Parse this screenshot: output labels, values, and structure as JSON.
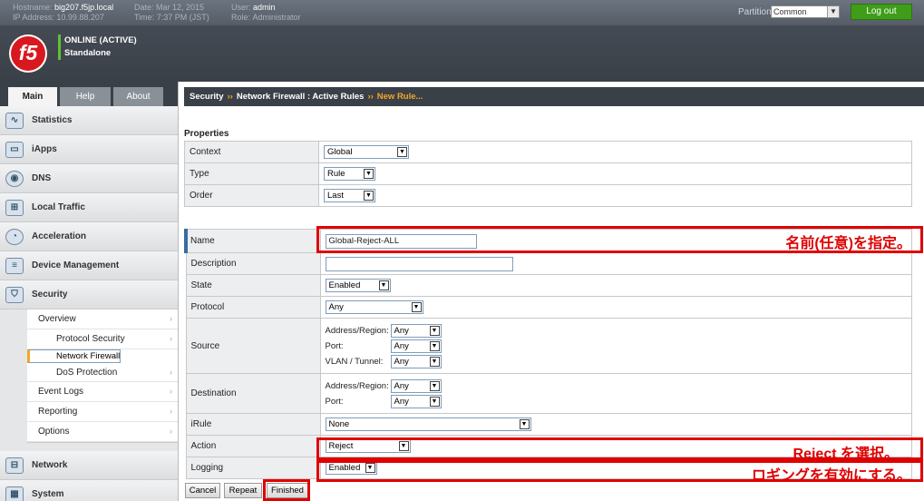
{
  "topbar": {
    "hostname_label": "Hostname:",
    "hostname": "big207.f5jp.local",
    "ip_label": "IP Address:",
    "ip": "10.99.88.207",
    "date_label": "Date:",
    "date": "Mar 12, 2015",
    "time_label": "Time:",
    "time": "7:37 PM (JST)",
    "user_label": "User:",
    "user": "admin",
    "role_label": "Role:",
    "role": "Administrator",
    "partition_label": "Partition:",
    "partition_value": "Common",
    "logout": "Log out"
  },
  "banner": {
    "logo_text": "f5",
    "status": "ONLINE (ACTIVE)",
    "mode": "Standalone"
  },
  "tabs": [
    "Main",
    "Help",
    "About"
  ],
  "nav": {
    "statistics": "Statistics",
    "iapps": "iApps",
    "dns": "DNS",
    "local_traffic": "Local Traffic",
    "acceleration": "Acceleration",
    "device_management": "Device Management",
    "security": "Security",
    "security_sub": [
      "Overview",
      "Protocol Security",
      "Network Firewall",
      "DoS Protection",
      "Event Logs",
      "Reporting",
      "Options"
    ],
    "network": "Network",
    "system": "System"
  },
  "breadcrumb": {
    "part1": "Security",
    "sep": "››",
    "part2": "Network Firewall : Active Rules",
    "current": "New Rule..."
  },
  "properties": {
    "title": "Properties",
    "context_label": "Context",
    "context_value": "Global",
    "type_label": "Type",
    "type_value": "Rule",
    "order_label": "Order",
    "order_value": "Last"
  },
  "rule": {
    "name_label": "Name",
    "name_value": "Global-Reject-ALL",
    "description_label": "Description",
    "description_value": "",
    "state_label": "State",
    "state_value": "Enabled",
    "protocol_label": "Protocol",
    "protocol_value": "Any",
    "source_label": "Source",
    "source_address_label": "Address/Region:",
    "source_address_value": "Any",
    "source_port_label": "Port:",
    "source_port_value": "Any",
    "source_vlan_label": "VLAN / Tunnel:",
    "source_vlan_value": "Any",
    "destination_label": "Destination",
    "dest_address_label": "Address/Region:",
    "dest_address_value": "Any",
    "dest_port_label": "Port:",
    "dest_port_value": "Any",
    "irule_label": "iRule",
    "irule_value": "None",
    "action_label": "Action",
    "action_value": "Reject",
    "logging_label": "Logging",
    "logging_value": "Enabled"
  },
  "annotations": {
    "name_note": "名前(任意)を指定。",
    "action_note": "Reject を選択。",
    "logging_note": "ロギングを有効にする。",
    "color": "#e00000"
  },
  "buttons": {
    "cancel": "Cancel",
    "repeat": "Repeat",
    "finished": "Finished"
  }
}
